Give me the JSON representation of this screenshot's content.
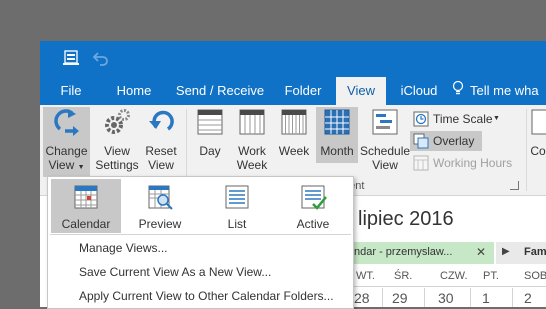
{
  "ribbon_tabs": {
    "file": "File",
    "home": "Home",
    "send_receive": "Send / Receive",
    "folder": "Folder",
    "view": "View",
    "icloud": "iCloud",
    "tell_me": "Tell me wha"
  },
  "ribbon": {
    "change_view": "Change View",
    "view_settings": "View Settings",
    "reset_view": "Reset View",
    "day": "Day",
    "work_week": "Work Week",
    "week": "Week",
    "month": "Month",
    "schedule_view": "Schedule View",
    "time_scale": "Time Scale",
    "overlay": "Overlay",
    "working_hours": "Working Hours",
    "group_label_partial": "ment",
    "cut_label": "Co"
  },
  "change_view_menu": {
    "views": [
      "Calendar",
      "Preview",
      "List",
      "Active"
    ],
    "items": [
      "Manage Views...",
      "Save Current View As a New View...",
      "Apply Current View to Other Calendar Folders..."
    ]
  },
  "calendar": {
    "month_title": "lipiec 2016",
    "tab_label": "ndar - przemyslaw...",
    "tab2_label": "Fam",
    "weekdays": [
      "WT.",
      "ŚR.",
      "CZW.",
      "PT.",
      "SOB"
    ],
    "dates": [
      "28",
      "29",
      "30",
      "1",
      "2"
    ]
  },
  "colors": {
    "title_bar": "#0f72c6",
    "ribbon_bg": "#f1f1f1",
    "selected": "#c8c8c8",
    "calendar_tab": "#c6e8c6"
  }
}
